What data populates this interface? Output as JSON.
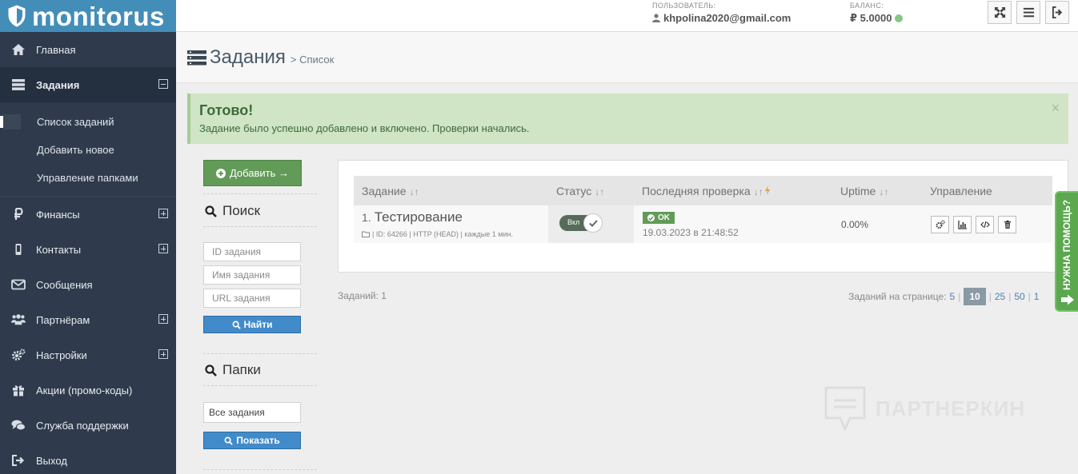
{
  "app": {
    "logo_text": "monitorus"
  },
  "header": {
    "user_caption": "ПОЛЬЗОВАТЕЛЬ:",
    "user_email": "khpolina2020@gmail.com",
    "balance_caption": "БАЛАНС:",
    "balance_value": "₽ 5.0000"
  },
  "sidebar": {
    "items": [
      {
        "label": "Главная",
        "icon": "home-icon"
      },
      {
        "label": "Задания",
        "icon": "tasks-icon"
      },
      {
        "label": "Финансы",
        "icon": "ruble-icon"
      },
      {
        "label": "Контакты",
        "icon": "phone-icon"
      },
      {
        "label": "Сообщения",
        "icon": "envelope-icon"
      },
      {
        "label": "Партнёрам",
        "icon": "users-icon"
      },
      {
        "label": "Настройки",
        "icon": "gears-icon"
      },
      {
        "label": "Акции (промо-коды)",
        "icon": "gift-icon"
      },
      {
        "label": "Служба поддержки",
        "icon": "comments-icon"
      },
      {
        "label": "Выход",
        "icon": "signout-icon"
      }
    ],
    "subitems": [
      {
        "label": "Список заданий"
      },
      {
        "label": "Добавить новое"
      },
      {
        "label": "Управление папками"
      }
    ]
  },
  "page": {
    "title": "Задания",
    "breadcrumb": "> Список"
  },
  "alert": {
    "title": "Готово!",
    "text": "Задание было успешно добавлено и включено. Проверки начались.",
    "close": "×"
  },
  "filters": {
    "add_label": "Добавить →",
    "search_title": "Поиск",
    "id_placeholder": "ID задания",
    "name_placeholder": "Имя задания",
    "url_placeholder": "URL задания",
    "find_label": "Найти",
    "folders_title": "Папки",
    "folder_value": "Все задания",
    "show_label": "Показать"
  },
  "table": {
    "headers": {
      "task": "Задание",
      "status": "Статус",
      "last_check": "Последняя проверка",
      "uptime": "Uptime",
      "manage": "Управление"
    },
    "sort_arrows": "↓↑",
    "rows": [
      {
        "num": "1.",
        "name": "Тестирование",
        "meta": "| ID: 64266 | HTTP (HEAD) | каждые 1 мин.",
        "toggle_label": "Вкл",
        "status_badge": "OK",
        "check_date": "19.03.2023 в 21:48:52",
        "uptime": "0.00%"
      }
    ]
  },
  "footer": {
    "count": "Заданий: 1",
    "perpage_label": "Заданий на странице:",
    "options": [
      "5",
      "10",
      "25",
      "50",
      "1"
    ],
    "active_option": "10"
  },
  "help_tab": {
    "label": "НУЖНА ПОМОЩЬ?"
  },
  "watermark": {
    "text": "ПАРТНЕРКИН"
  },
  "colors": {
    "logo_bg": "#438eb9",
    "sidebar_bg": "#2f3b4c",
    "success_green": "#629b58",
    "primary_blue": "#428bca",
    "alert_bg": "#cfe5c5"
  }
}
